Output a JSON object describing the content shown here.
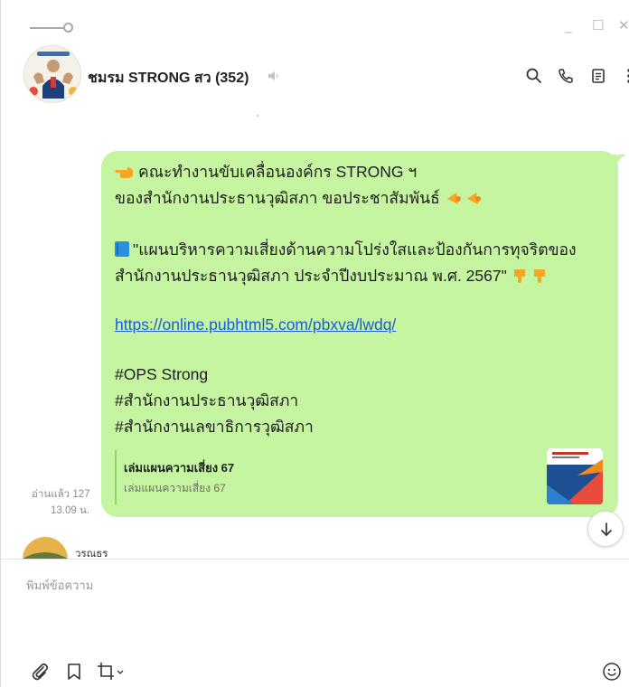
{
  "header": {
    "room_name": "ชมรม STRONG สว (352)"
  },
  "message": {
    "line1": "คณะทำงานขับเคลื่อนองค์กร STRONG ฯ",
    "line2": "ของสำนักงานประธานวุฒิสภา ขอประชาสัมพันธ์",
    "line3": "\"แผนบริหารความเสี่ยงด้านความโปร่งใสและป้องกันการทุจริตของ",
    "line4": "สำนักงานประธานวุฒิสภา ประจำปีงบประมาณ พ.ศ. 2567\"",
    "link": "https://online.pubhtml5.com/pbxva/lwdq/",
    "tag1": "#OPS Strong",
    "tag2": "#สำนักงานประธานวุฒิสภา",
    "tag3": "#สำนักงานเลขาธิการวุฒิสภา",
    "bubble_color": "#c6f5a1",
    "link_color": "#1a5bd6"
  },
  "preview": {
    "title": "เล่มแผนความเสี่ยง 67",
    "subtitle": "เล่มแผนความเสี่ยง 67"
  },
  "read_info": {
    "read_count": "อ่านแล้ว 127",
    "time": "13.09 น."
  },
  "next_message": {
    "sender": "วรณธร"
  },
  "input": {
    "placeholder": "พิมพ์ข้อความ"
  },
  "icons": [
    "pin-icon",
    "minimize-icon",
    "maximize-icon",
    "close-icon",
    "mute-icon",
    "search-icon",
    "phone-icon",
    "notes-icon",
    "more-icon",
    "scroll-down-icon",
    "paperclip-icon",
    "bookmark-icon",
    "crop-icon",
    "emoji-icon"
  ]
}
